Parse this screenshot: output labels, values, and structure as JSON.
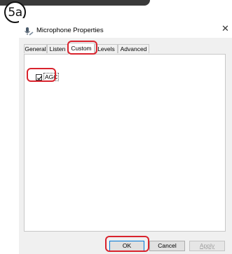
{
  "step_label": "5a",
  "window": {
    "title": "Microphone Properties",
    "close_glyph": "✕"
  },
  "tabs": [
    {
      "label": "General",
      "active": false
    },
    {
      "label": "Listen",
      "active": false
    },
    {
      "label": "Custom",
      "active": true
    },
    {
      "label": "Levels",
      "active": false
    },
    {
      "label": "Advanced",
      "active": false
    }
  ],
  "custom": {
    "agc_label": "AGC",
    "agc_checked": true
  },
  "buttons": {
    "ok": "OK",
    "cancel": "Cancel",
    "apply": "Apply"
  },
  "colors": {
    "highlight": "#d9232d",
    "dialog_bg": "#f0f0f0",
    "ok_border": "#0078d7"
  },
  "icons": {
    "window": "microphone-icon",
    "close": "close-icon",
    "check": "checkmark-icon"
  }
}
